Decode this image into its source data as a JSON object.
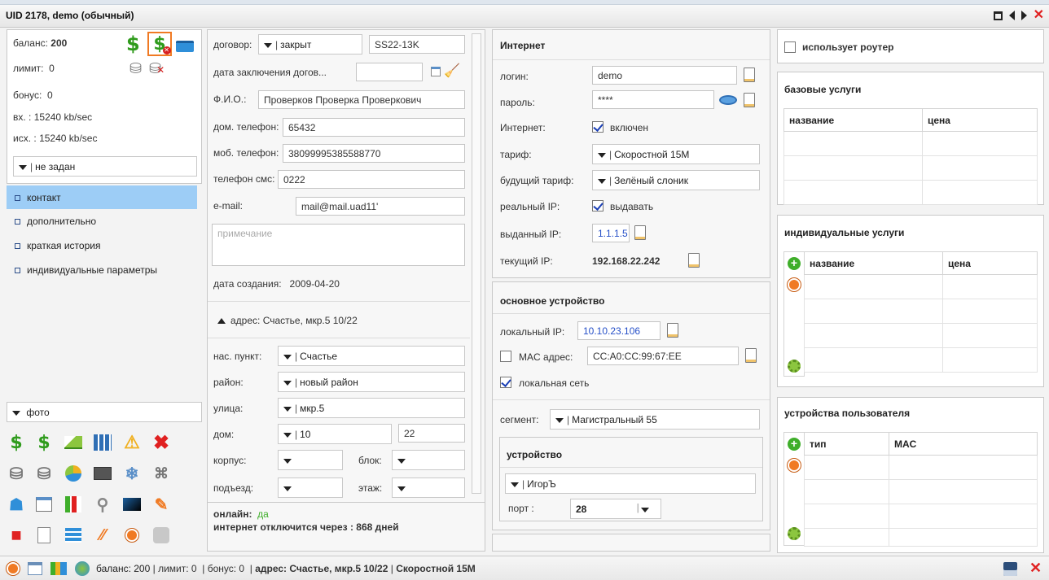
{
  "window": {
    "title": "UID 2178, demo (обычный)"
  },
  "balance_panel": {
    "balance_label": "баланс:",
    "balance_value": "200",
    "limit_label": "лимит:",
    "limit_value": "0",
    "bonus_label": "бонус:",
    "bonus_value": "0",
    "in_label": "вх.  :",
    "in_value": "15240 kb/sec",
    "out_label": "исх. :",
    "out_value": "15240 kb/sec",
    "group_select": "не задан"
  },
  "nav": {
    "items": [
      {
        "label": "контакт"
      },
      {
        "label": "дополнительно"
      },
      {
        "label": "краткая история"
      },
      {
        "label": "индивидуальные параметры"
      }
    ],
    "photo_label": "фото"
  },
  "contract": {
    "contract_label": "договор:",
    "contract_status": "закрыт",
    "contract_number": "SS22-13K",
    "contract_date_label": "дата заключения догов...",
    "fio_label": "Ф.И.О.:",
    "fio_value": "Проверков Проверка Проверкович",
    "home_phone_label": "дом. телефон:",
    "home_phone_value": "65432",
    "mob_phone_label": "моб. телефон:",
    "mob_phone_value": "38099995385588770",
    "sms_phone_label": "телефон смс:",
    "sms_phone_value": "0222",
    "email_label": "e-mail:",
    "email_value": "mail@mail.uad11'",
    "note_placeholder": "примечание",
    "created_label": "дата создания:",
    "created_value": "2009-04-20"
  },
  "address": {
    "header": "адрес: Счастье, мкр.5 10/22",
    "locality_label": "нас. пункт:",
    "locality_value": "Счастье",
    "district_label": "район:",
    "district_value": "новый район",
    "street_label": "улица:",
    "street_value": "мкр.5",
    "house_label": "дом:",
    "house_value": "10",
    "flat_value": "22",
    "building_label": "корпус:",
    "block_label": "блок:",
    "entrance_label": "подъезд:",
    "floor_label": "этаж:"
  },
  "online": {
    "online_label": "онлайн:",
    "online_value": "да",
    "disconnect_text": "интернет отключится через : 868 дней"
  },
  "internet": {
    "header": "Интернет",
    "login_label": "логин:",
    "login_value": "demo",
    "password_label": "пароль:",
    "password_value": "****",
    "internet_label": "Интернет:",
    "internet_checkbox": "включен",
    "tariff_label": "тариф:",
    "tariff_value": "Скоростной 15М",
    "future_tariff_label": "будущий тариф:",
    "future_tariff_value": "Зелёный слоник",
    "real_ip_label": "реальный IP:",
    "real_ip_checkbox": "выдавать",
    "issued_ip_label": "выданный IP:",
    "issued_ip_value": "1.1.1.5",
    "current_ip_label": "текущий IP:",
    "current_ip_value": "192.168.22.242"
  },
  "device": {
    "header": "основное устройство",
    "local_ip_label": "локальный IP:",
    "local_ip_value": "10.10.23.106",
    "mac_label": "MAC адрес:",
    "mac_value": "CC:A0:CC:99:67:EE",
    "local_net_label": "локальная сеть",
    "segment_label": "сегмент:",
    "segment_value": "Магистральный 55",
    "device_header": "устройство",
    "device_value": "ИгорЪ",
    "port_label": "порт :",
    "port_value": "28"
  },
  "right": {
    "router_label": "использует роутер",
    "base_services_header": "базовые услуги",
    "base_col_name": "название",
    "base_col_price": "цена",
    "indiv_services_header": "индивидуальные услуги",
    "indiv_col_name": "название",
    "indiv_col_price": "цена",
    "user_devices_header": "устройства пользователя",
    "dev_col_type": "тип",
    "dev_col_mac": "MAC"
  },
  "statusbar": {
    "balance": "баланс: 200",
    "limit": "лимит: 0",
    "bonus": "бонус: 0",
    "address": "адрес: Счастье, мкр.5 10/22",
    "tariff": "Скоростной 15М",
    "separator": "|"
  },
  "colors": {
    "accent_selected": "#9dcdf6",
    "money_green": "#2f9b1c",
    "danger_red": "#e02020",
    "link_blue": "#2650c8"
  }
}
